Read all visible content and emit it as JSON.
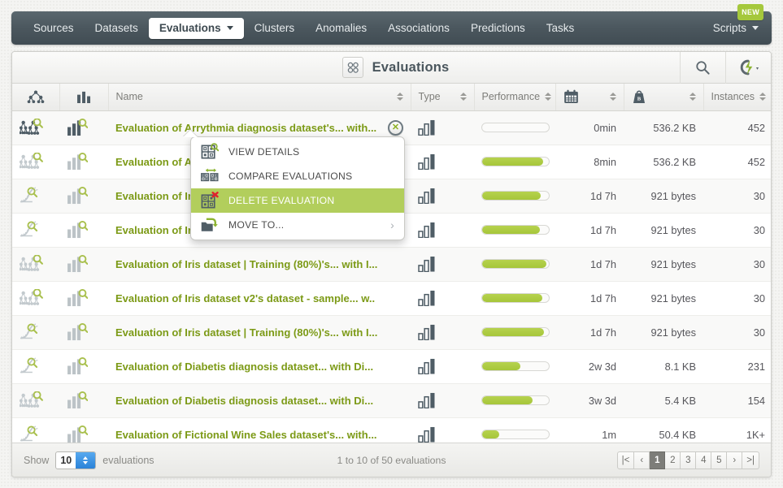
{
  "nav": {
    "items": [
      {
        "label": "Sources",
        "active": false
      },
      {
        "label": "Datasets",
        "active": false
      },
      {
        "label": "Evaluations",
        "active": true
      },
      {
        "label": "Clusters",
        "active": false
      },
      {
        "label": "Anomalies",
        "active": false
      },
      {
        "label": "Associations",
        "active": false
      },
      {
        "label": "Predictions",
        "active": false
      },
      {
        "label": "Tasks",
        "active": false
      }
    ],
    "scripts_label": "Scripts",
    "new_badge": "NEW"
  },
  "header": {
    "title": "Evaluations",
    "grid_icon": "grid-icon",
    "search_icon": "search-icon",
    "bolt_icon": "bolt-icon"
  },
  "table": {
    "columns": [
      {
        "key": "model",
        "label": "",
        "icon": "model-icon",
        "sortable": false
      },
      {
        "key": "evaluation",
        "label": "",
        "icon": "bars-icon",
        "sortable": false
      },
      {
        "key": "name",
        "label": "Name",
        "sortable": true
      },
      {
        "key": "type",
        "label": "Type",
        "sortable": true
      },
      {
        "key": "performance",
        "label": "Performance",
        "sortable": true
      },
      {
        "key": "age",
        "label": "",
        "icon": "calendar-icon",
        "sortable": true
      },
      {
        "key": "size",
        "label": "",
        "icon": "weight-icon",
        "sortable": true
      },
      {
        "key": "instances",
        "label": "Instances",
        "sortable": true
      }
    ],
    "rows": [
      {
        "model_icon": "ensemble-icon",
        "model_state": "dark",
        "eval_icon": "bars-search-icon",
        "eval_state": "dark",
        "name": "Evaluation of Arrythmia diagnosis dataset's... with...",
        "has_close": true,
        "type_icon": "bars-icon",
        "performance": 0,
        "age": "0min",
        "size": "536.2 KB",
        "instances": "452"
      },
      {
        "model_icon": "ensemble-icon",
        "model_state": "light",
        "eval_icon": "bars-search-icon",
        "eval_state": "light",
        "name": "Evaluation of A",
        "has_close": false,
        "type_icon": "bars-icon",
        "performance": 92,
        "age": "8min",
        "size": "536.2 KB",
        "instances": "452"
      },
      {
        "model_icon": "anomaly-icon",
        "model_state": "light",
        "eval_icon": "bars-search-icon",
        "eval_state": "light",
        "name": "Evaluation of Ir",
        "has_close": false,
        "type_icon": "bars-icon",
        "performance": 88,
        "age": "1d 7h",
        "size": "921 bytes",
        "instances": "30"
      },
      {
        "model_icon": "anomaly-icon",
        "model_state": "light",
        "eval_icon": "bars-search-icon",
        "eval_state": "light",
        "name": "Evaluation of Ir",
        "has_close": false,
        "type_icon": "bars-icon",
        "performance": 87,
        "age": "1d 7h",
        "size": "921 bytes",
        "instances": "30"
      },
      {
        "model_icon": "ensemble-icon",
        "model_state": "light",
        "eval_icon": "bars-search-icon",
        "eval_state": "light",
        "name": "Evaluation of Iris dataset | Training (80%)'s... with I...",
        "has_close": false,
        "type_icon": "bars-icon",
        "performance": 96,
        "age": "1d 7h",
        "size": "921 bytes",
        "instances": "30"
      },
      {
        "model_icon": "ensemble-icon",
        "model_state": "light",
        "eval_icon": "bars-search-icon",
        "eval_state": "light",
        "name": "Evaluation of Iris dataset v2's dataset - sample... w..",
        "has_close": false,
        "type_icon": "bars-icon",
        "performance": 90,
        "age": "1d 7h",
        "size": "921 bytes",
        "instances": "30"
      },
      {
        "model_icon": "anomaly-icon",
        "model_state": "light",
        "eval_icon": "bars-search-icon",
        "eval_state": "light",
        "name": "Evaluation of Iris dataset | Training (80%)'s... with I...",
        "has_close": false,
        "type_icon": "bars-icon",
        "performance": 93,
        "age": "1d 7h",
        "size": "921 bytes",
        "instances": "30"
      },
      {
        "model_icon": "anomaly-icon",
        "model_state": "light",
        "eval_icon": "bars-search-icon",
        "eval_state": "light",
        "name": "Evaluation of Diabetis diagnosis dataset... with Di...",
        "has_close": false,
        "type_icon": "bars-icon",
        "performance": 57,
        "age": "2w 3d",
        "size": "8.1 KB",
        "instances": "231"
      },
      {
        "model_icon": "ensemble-icon",
        "model_state": "light",
        "eval_icon": "bars-search-icon",
        "eval_state": "light",
        "name": "Evaluation of Diabetis diagnosis dataset... with Di...",
        "has_close": false,
        "type_icon": "bars-icon",
        "performance": 75,
        "age": "3w 3d",
        "size": "5.4 KB",
        "instances": "154"
      },
      {
        "model_icon": "anomaly-icon",
        "model_state": "light",
        "eval_icon": "bars-search-icon",
        "eval_state": "light",
        "name": "Evaluation of Fictional Wine Sales dataset's... with...",
        "has_close": false,
        "type_icon": "bars-icon",
        "performance": 26,
        "age": "1m",
        "size": "50.4 KB",
        "instances": "1K+"
      }
    ]
  },
  "context_menu": {
    "items": [
      {
        "label": "VIEW DETAILS",
        "icon": "view-details-icon",
        "selected": false,
        "has_submenu": false
      },
      {
        "label": "COMPARE EVALUATIONS",
        "icon": "compare-evaluations-icon",
        "selected": false,
        "has_submenu": false
      },
      {
        "label": "DELETE EVALUATION",
        "icon": "delete-evaluation-icon",
        "selected": true,
        "has_submenu": false
      },
      {
        "label": "MOVE TO...",
        "icon": "move-to-icon",
        "selected": false,
        "has_submenu": true
      }
    ]
  },
  "footer": {
    "show_label": "Show",
    "show_value": "10",
    "entity_label": "evaluations",
    "count_text": "1 to 10 of 50 evaluations",
    "pages": [
      "1",
      "2",
      "3",
      "4",
      "5"
    ],
    "active_page": "1",
    "first_label": "|<",
    "prev_label": "‹",
    "next_label": "›",
    "last_label": ">|"
  },
  "colors": {
    "accent_green": "#7c9a16",
    "bar_green": "#a6c63a",
    "menu_highlight": "#b2ce5c",
    "nav_dark": "#4b575e"
  }
}
